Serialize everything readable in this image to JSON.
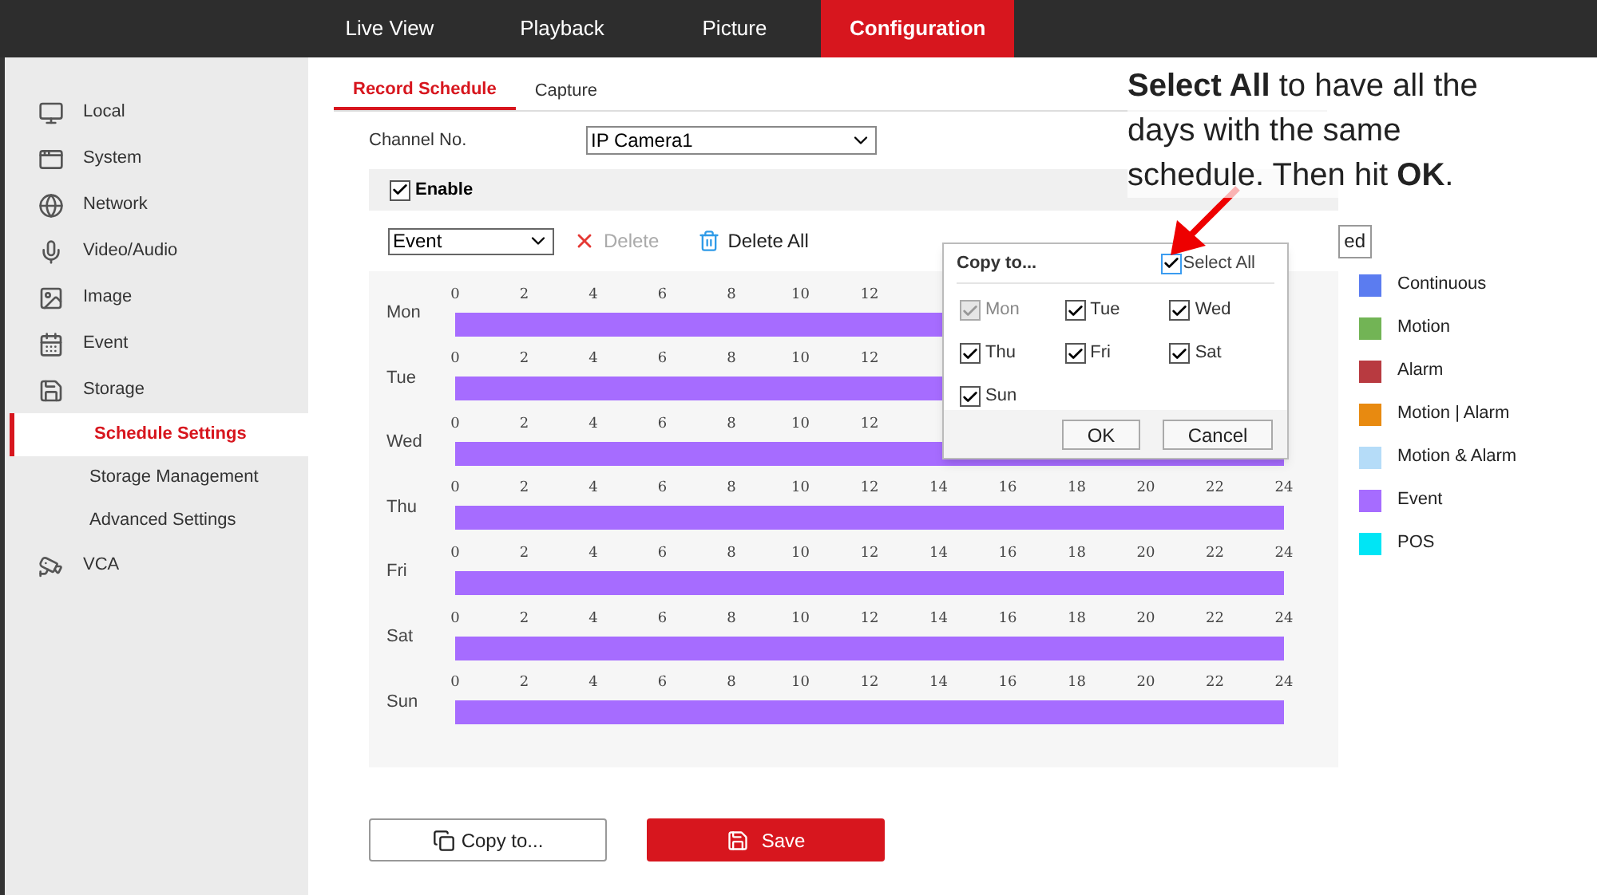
{
  "nav_tabs": [
    {
      "label": "Live View",
      "selected": false
    },
    {
      "label": "Playback",
      "selected": false
    },
    {
      "label": "Picture",
      "selected": false
    },
    {
      "label": "Configuration",
      "selected": true
    }
  ],
  "sidebar": {
    "items": [
      {
        "label": "Local",
        "selected": false
      },
      {
        "label": "System",
        "selected": false
      },
      {
        "label": "Network",
        "selected": false
      },
      {
        "label": "Video/Audio",
        "selected": false
      },
      {
        "label": "Image",
        "selected": false
      },
      {
        "label": "Event",
        "selected": false
      },
      {
        "label": "Storage",
        "selected": false,
        "children": [
          {
            "label": "Schedule Settings",
            "selected": true
          },
          {
            "label": "Storage Management",
            "selected": false
          },
          {
            "label": "Advanced Settings",
            "selected": false
          }
        ]
      },
      {
        "label": "VCA",
        "selected": false
      }
    ]
  },
  "sub_tabs": [
    {
      "label": "Record Schedule",
      "selected": true
    },
    {
      "label": "Capture",
      "selected": false
    }
  ],
  "channel": {
    "label": "Channel No.",
    "value": "IP Camera1"
  },
  "enable": {
    "label": "Enable",
    "checked": true
  },
  "toolbar": {
    "type_value": "Event",
    "delete": {
      "label": "Delete",
      "disabled": true
    },
    "delete_all": "Delete All",
    "partial_button": "ed"
  },
  "schedule": {
    "rows": [
      {
        "day": "Mon",
        "ticks": [
          "0",
          "2",
          "4",
          "6",
          "8",
          "10",
          "12"
        ]
      },
      {
        "day": "Tue",
        "ticks": [
          "0",
          "2",
          "4",
          "6",
          "8",
          "10",
          "12"
        ]
      },
      {
        "day": "Wed",
        "ticks": [
          "0",
          "2",
          "4",
          "6",
          "8",
          "10",
          "12"
        ]
      },
      {
        "day": "Thu",
        "ticks": [
          "0",
          "2",
          "4",
          "6",
          "8",
          "10",
          "12",
          "14",
          "16",
          "18",
          "20",
          "22",
          "24"
        ]
      },
      {
        "day": "Fri",
        "ticks": [
          "0",
          "2",
          "4",
          "6",
          "8",
          "10",
          "12",
          "14",
          "16",
          "18",
          "20",
          "22",
          "24"
        ]
      },
      {
        "day": "Sat",
        "ticks": [
          "0",
          "2",
          "4",
          "6",
          "8",
          "10",
          "12",
          "14",
          "16",
          "18",
          "20",
          "22",
          "24"
        ]
      },
      {
        "day": "Sun",
        "ticks": [
          "0",
          "2",
          "4",
          "6",
          "8",
          "10",
          "12",
          "14",
          "16",
          "18",
          "20",
          "22",
          "24"
        ]
      }
    ]
  },
  "legend": [
    {
      "label": "Continuous",
      "color": "#5b7cf0"
    },
    {
      "label": "Motion",
      "color": "#72b455"
    },
    {
      "label": "Alarm",
      "color": "#b83a40"
    },
    {
      "label": "Motion | Alarm",
      "color": "#e88a10"
    },
    {
      "label": "Motion & Alarm",
      "color": "#b5dcf8"
    },
    {
      "label": "Event",
      "color": "#a66cff"
    },
    {
      "label": "POS",
      "color": "#00e5f5"
    }
  ],
  "copy_dialog": {
    "title": "Copy to...",
    "select_all": {
      "label": "Select All",
      "checked": true
    },
    "days": [
      {
        "label": "Mon",
        "checked": true,
        "disabled": true
      },
      {
        "label": "Tue",
        "checked": true,
        "disabled": false
      },
      {
        "label": "Wed",
        "checked": true,
        "disabled": false
      },
      {
        "label": "Thu",
        "checked": true,
        "disabled": false
      },
      {
        "label": "Fri",
        "checked": true,
        "disabled": false
      },
      {
        "label": "Sat",
        "checked": true,
        "disabled": false
      },
      {
        "label": "Sun",
        "checked": true,
        "disabled": false
      }
    ],
    "buttons": [
      "OK",
      "Cancel"
    ]
  },
  "actions": {
    "copy": "Copy to...",
    "save": "Save"
  },
  "annotation": "**Select All** to have all the days with the same schedule. Then hit **OK**."
}
